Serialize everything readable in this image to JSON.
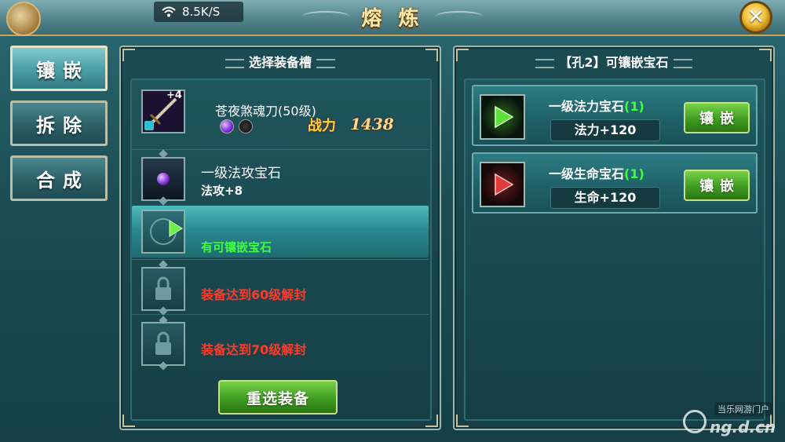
{
  "status": {
    "network_speed": "8.5K/S"
  },
  "window": {
    "title": "熔 炼",
    "close_label": "✕"
  },
  "nav": {
    "items": [
      {
        "label": "镶嵌",
        "active": true
      },
      {
        "label": "拆除",
        "active": false
      },
      {
        "label": "合成",
        "active": false
      }
    ]
  },
  "equip_panel": {
    "header": "选择装备槽",
    "item": {
      "name": "苍夜煞魂刀(50级)",
      "enhance_level": "+4",
      "power_label": "战力",
      "power_value": "1438"
    },
    "slots": [
      {
        "title": "一级法攻宝石",
        "detail": "法攻+8",
        "state": "filled",
        "gem_color": "#7b2bd0"
      },
      {
        "title": "",
        "detail": "有可镶嵌宝石",
        "state": "available",
        "gem_color": "#5ee03a"
      },
      {
        "title": "",
        "detail": "装备达到60级解封",
        "state": "locked"
      },
      {
        "title": "",
        "detail": "装备达到70级解封",
        "state": "locked"
      }
    ],
    "reselect_button": "重选装备"
  },
  "gem_panel": {
    "header": "【孔2】可镶嵌宝石",
    "gems": [
      {
        "name": "一级法力宝石",
        "count": "(1)",
        "stat": "法力+120",
        "button": "镶嵌",
        "color": "#4fe03a"
      },
      {
        "name": "一级生命宝石",
        "count": "(1)",
        "stat": "生命+120",
        "button": "镶嵌",
        "color": "#e03a3a"
      }
    ]
  },
  "watermark": {
    "site": "当乐网游门户",
    "domain": "ng.d.cn"
  }
}
